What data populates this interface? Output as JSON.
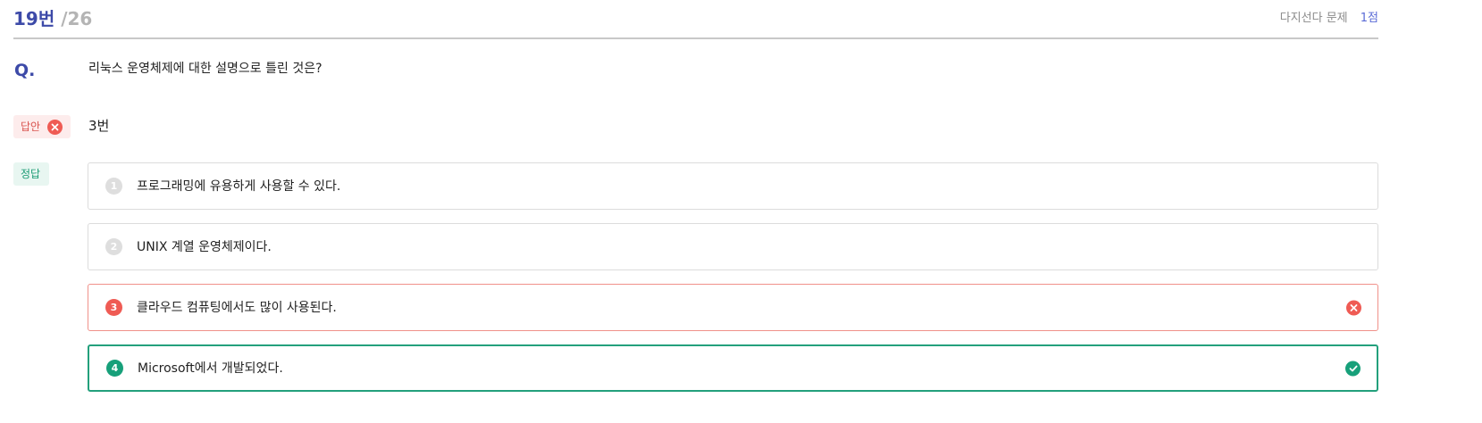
{
  "header": {
    "question_number": "19번",
    "total": "/26",
    "question_type": "다지선다 문제",
    "points": "1점"
  },
  "question": {
    "label": "Q.",
    "text": "리눅스 운영체제에 대한 설명으로 틀린 것은?"
  },
  "user_answer": {
    "label": "답안",
    "status_icon": "x-circle-icon",
    "value": "3번"
  },
  "correct_answer": {
    "label": "정답"
  },
  "options": [
    {
      "number": "1",
      "text": "프로그래밍에 유용하게 사용할 수 있다.",
      "state": "neutral"
    },
    {
      "number": "2",
      "text": "UNIX 계열 운영체제이다.",
      "state": "neutral"
    },
    {
      "number": "3",
      "text": "클라우드 컴퓨팅에서도 많이 사용된다.",
      "state": "wrong"
    },
    {
      "number": "4",
      "text": "Microsoft에서 개발되었다.",
      "state": "correct"
    }
  ],
  "colors": {
    "accent": "#3d4aa8",
    "wrong": "#ef5b54",
    "correct": "#17a07a"
  }
}
